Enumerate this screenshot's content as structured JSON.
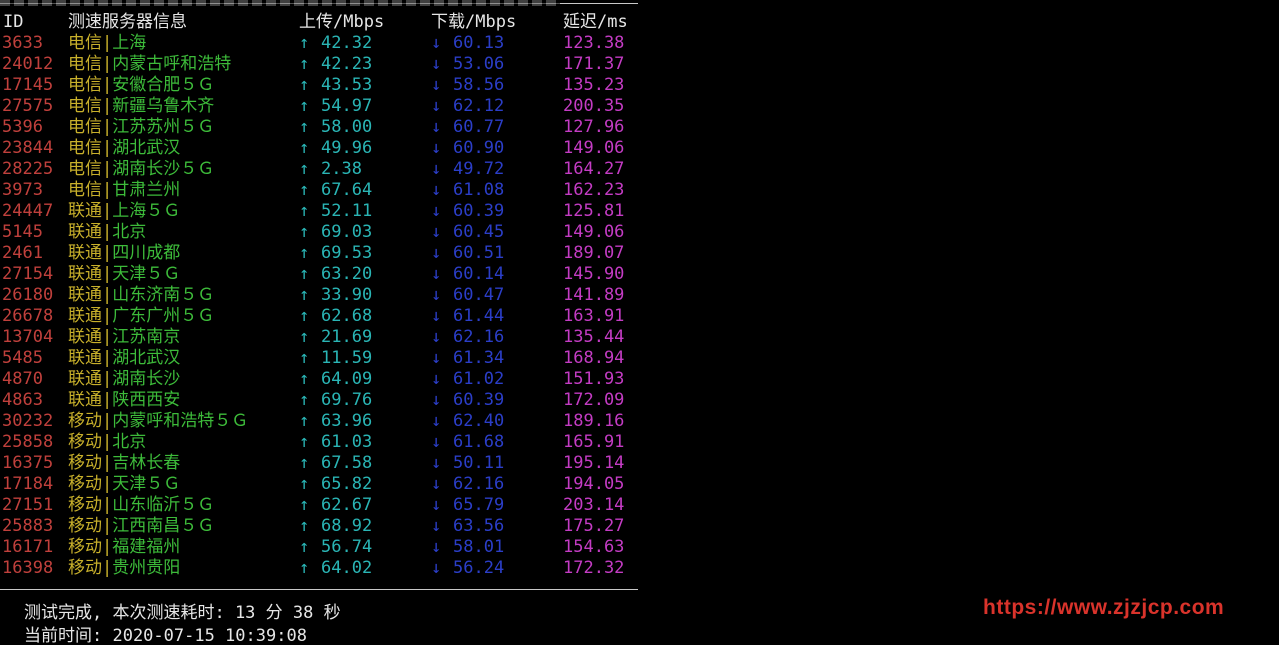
{
  "header": {
    "id": "ID",
    "server": "测速服务器信息",
    "upload": "上传/Mbps",
    "download": "下载/Mbps",
    "latency": "延迟/ms"
  },
  "arrows": {
    "up": "↑",
    "down": "↓"
  },
  "separator": "|",
  "rows": [
    {
      "id": "3633",
      "isp": "电信",
      "city": "上海",
      "up": "42.32",
      "down": "60.13",
      "lat": "123.38"
    },
    {
      "id": "24012",
      "isp": "电信",
      "city": "内蒙古呼和浩特",
      "up": "42.23",
      "down": "53.06",
      "lat": "171.37"
    },
    {
      "id": "17145",
      "isp": "电信",
      "city": "安徽合肥５Ｇ",
      "up": "43.53",
      "down": "58.56",
      "lat": "135.23"
    },
    {
      "id": "27575",
      "isp": "电信",
      "city": "新疆乌鲁木齐",
      "up": "54.97",
      "down": "62.12",
      "lat": "200.35"
    },
    {
      "id": "5396",
      "isp": "电信",
      "city": "江苏苏州５Ｇ",
      "up": "58.00",
      "down": "60.77",
      "lat": "127.96"
    },
    {
      "id": "23844",
      "isp": "电信",
      "city": "湖北武汉",
      "up": "49.96",
      "down": "60.90",
      "lat": "149.06"
    },
    {
      "id": "28225",
      "isp": "电信",
      "city": "湖南长沙５Ｇ",
      "up": "2.38",
      "down": "49.72",
      "lat": "164.27"
    },
    {
      "id": "3973",
      "isp": "电信",
      "city": "甘肃兰州",
      "up": "67.64",
      "down": "61.08",
      "lat": "162.23"
    },
    {
      "id": "24447",
      "isp": "联通",
      "city": "上海５Ｇ",
      "up": "52.11",
      "down": "60.39",
      "lat": "125.81"
    },
    {
      "id": "5145",
      "isp": "联通",
      "city": "北京",
      "up": "69.03",
      "down": "60.45",
      "lat": "149.06"
    },
    {
      "id": "2461",
      "isp": "联通",
      "city": "四川成都",
      "up": "69.53",
      "down": "60.51",
      "lat": "189.07"
    },
    {
      "id": "27154",
      "isp": "联通",
      "city": "天津５Ｇ",
      "up": "63.20",
      "down": "60.14",
      "lat": "145.90"
    },
    {
      "id": "26180",
      "isp": "联通",
      "city": "山东济南５Ｇ",
      "up": "33.90",
      "down": "60.47",
      "lat": "141.89"
    },
    {
      "id": "26678",
      "isp": "联通",
      "city": "广东广州５Ｇ",
      "up": "62.68",
      "down": "61.44",
      "lat": "163.91"
    },
    {
      "id": "13704",
      "isp": "联通",
      "city": "江苏南京",
      "up": "21.69",
      "down": "62.16",
      "lat": "135.44"
    },
    {
      "id": "5485",
      "isp": "联通",
      "city": "湖北武汉",
      "up": "11.59",
      "down": "61.34",
      "lat": "168.94"
    },
    {
      "id": "4870",
      "isp": "联通",
      "city": "湖南长沙",
      "up": "64.09",
      "down": "61.02",
      "lat": "151.93"
    },
    {
      "id": "4863",
      "isp": "联通",
      "city": "陕西西安",
      "up": "69.76",
      "down": "60.39",
      "lat": "172.09"
    },
    {
      "id": "30232",
      "isp": "移动",
      "city": "内蒙呼和浩特５Ｇ",
      "up": "63.96",
      "down": "62.40",
      "lat": "189.16"
    },
    {
      "id": "25858",
      "isp": "移动",
      "city": "北京",
      "up": "61.03",
      "down": "61.68",
      "lat": "165.91"
    },
    {
      "id": "16375",
      "isp": "移动",
      "city": "吉林长春",
      "up": "67.58",
      "down": "50.11",
      "lat": "195.14"
    },
    {
      "id": "17184",
      "isp": "移动",
      "city": "天津５Ｇ",
      "up": "65.82",
      "down": "62.16",
      "lat": "194.05"
    },
    {
      "id": "27151",
      "isp": "移动",
      "city": "山东临沂５Ｇ",
      "up": "62.67",
      "down": "65.79",
      "lat": "203.14"
    },
    {
      "id": "25883",
      "isp": "移动",
      "city": "江西南昌５Ｇ",
      "up": "68.92",
      "down": "63.56",
      "lat": "175.27"
    },
    {
      "id": "16171",
      "isp": "移动",
      "city": "福建福州",
      "up": "56.74",
      "down": "58.01",
      "lat": "154.63"
    },
    {
      "id": "16398",
      "isp": "移动",
      "city": "贵州贵阳",
      "up": "64.02",
      "down": "56.24",
      "lat": "172.32"
    }
  ],
  "footer": {
    "done": "测试完成, 本次测速耗时: 13 分 38 秒",
    "time": "当前时间: 2020-07-15 10:39:08"
  },
  "watermark": "https://www.zjzjcp.com"
}
